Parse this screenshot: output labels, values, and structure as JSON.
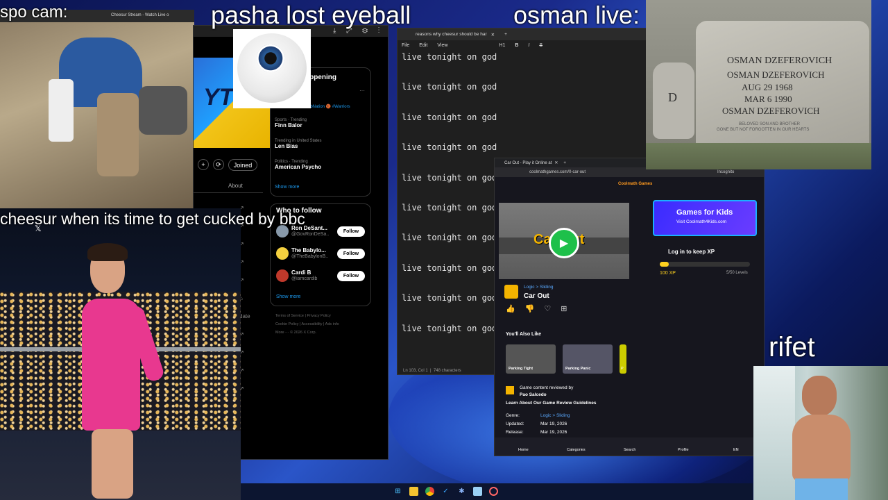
{
  "overlays": {
    "spo_cam": "spo cam:",
    "pasha": "pasha lost eyeball",
    "osman": "osman live:",
    "cheesur": "cheesur when its time to get cucked by bbc",
    "rifet": "rifet"
  },
  "spo_browser": {
    "tab_title": "Cheesur Stream - Watch Live o"
  },
  "x_app": {
    "banner_text": "YT",
    "happening_title": "oppening",
    "happening_hashtag": "ubNation 🏀 #Warriors",
    "profile_action_joined": "Joined",
    "about_label": "About",
    "trends": [
      {
        "meta": "Sports · Trending",
        "name": "Finn Balor"
      },
      {
        "meta": "Trending in United States",
        "name": "Len Bias"
      },
      {
        "meta": "Politics · Trending",
        "name": "American Psycho"
      }
    ],
    "show_more_trends": "Show more",
    "who_to_follow_title": "Who to follow",
    "accounts": [
      {
        "name": "Ron DeSant...",
        "handle": "@GovRonDeSa..",
        "follow": "Follow"
      },
      {
        "name": "The Babylo...",
        "handle": "@TheBabylonB..",
        "follow": "Follow"
      },
      {
        "name": "Cardi B",
        "handle": "@iamcardib",
        "follow": "Follow"
      }
    ],
    "show_more_follow": "Show more",
    "footer": [
      "Terms of Service",
      "Privacy Policy",
      "Cookie Policy",
      "Accessibility",
      "Ads info",
      "More ···",
      "© 2026 X Corp."
    ],
    "side_labls": [
      "date"
    ]
  },
  "doc_app": {
    "tab_title": "reasons why cheesur should be har",
    "menu": [
      "File",
      "Edit",
      "View"
    ],
    "toolbar": [
      "H1",
      "B",
      "I",
      "S"
    ],
    "lines": [
      "live tonight on god",
      "live tonight on god",
      "live tonight on god",
      "live tonight on god",
      "live tonight on god",
      "live tonight on god",
      "live tonight on god",
      "live tonight on god",
      "live tonight on god",
      "live tonight on god"
    ],
    "status_position": "Ln 103, Col 1",
    "status_chars": "748 characters"
  },
  "coolmath": {
    "tab_title": "Car Out - Play it Online at",
    "url": "coolmathgames.com/0-car-out",
    "incognito": "Incognito",
    "logo": "Coolmath Games",
    "game_banner_text": "Car Out",
    "category": "Logic > Sliding",
    "game_title": "Car Out",
    "promo_title": "Games for Kids",
    "promo_sub": "Visit Coolmath4Kids.com",
    "login_prompt": "Log in to keep XP",
    "xp": "100 XP",
    "levels": "5/50 Levels",
    "xp_progress": 0.1,
    "also_like_title": "You'll Also Like",
    "also_like": [
      "Parking Tight",
      "Parking Panic",
      "P"
    ],
    "review_line1": "Game content reviewed by",
    "reviewer": "Pao Salcedo",
    "review_link": "Learn About Our Game Review Guidelines",
    "details": [
      {
        "label": "Genre:",
        "value": "Logic > Sliding"
      },
      {
        "label": "Updated:",
        "value": "Mar 19, 2026"
      },
      {
        "label": "Release:",
        "value": "Mar 19, 2026"
      }
    ],
    "nav": [
      "Home",
      "Categories",
      "Search",
      "Profile",
      "EN"
    ]
  },
  "gravestone": {
    "lines": [
      "OSMAN DZEFEROVICH",
      "OSMAN DZEFEROVICH",
      "AUG 29 1968",
      "MAR 6 1990",
      "OSMAN DZEFEROVICH"
    ],
    "epitaph1": "BELOVED SON AND BROTHER",
    "epitaph2": "GONE BUT NOT FORGOTTEN IN OUR HEARTS",
    "vase_letter": "D"
  },
  "colors": {
    "accent_blue": "#1d9bf0",
    "xp_yellow": "#ffd21f",
    "dress_pink": "#e8388f"
  }
}
